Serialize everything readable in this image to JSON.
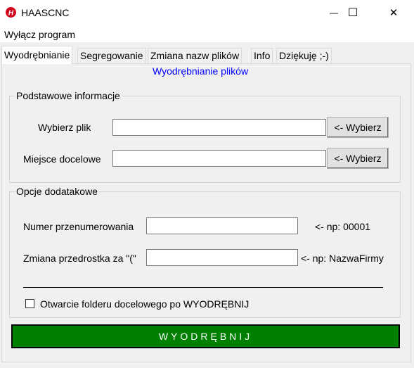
{
  "window": {
    "title": "HAASCNC",
    "icon": "haas-logo-icon",
    "minimize_glyph": "—",
    "maximize_glyph": "☐",
    "close_glyph": "✕"
  },
  "menu": {
    "items": [
      {
        "label": "Wyłącz program"
      }
    ]
  },
  "tabs": [
    {
      "label": "Wyodrębnianie",
      "active": true
    },
    {
      "label": "Segregowanie",
      "active": false
    },
    {
      "label": "Zmiana nazw plików",
      "active": false
    },
    {
      "label": "Info",
      "active": false
    },
    {
      "label": "Dziękuję ;-)",
      "active": false
    }
  ],
  "panel": {
    "title": "Wyodrębnianie plików",
    "basic": {
      "legend": "Podstawowe informacje",
      "file_label": "Wybierz plik",
      "file_value": "",
      "file_button": "<- Wybierz",
      "dest_label": "Miejsce docelowe",
      "dest_value": "",
      "dest_button": "<- Wybierz"
    },
    "options": {
      "legend": "Opcje dodatakowe",
      "renumber_label": "Numer przenumerowania",
      "renumber_value": "",
      "renumber_hint": "<- np: 00001",
      "prefix_label": "Zmiana przedrostka za \"(\"",
      "prefix_value": "",
      "prefix_hint": "<- np: NazwaFirmy",
      "open_folder_label": "Otwarcie folderu docelowego po WYODRĘBNIJ",
      "open_folder_checked": false
    },
    "extract_button": "WYODRĘBNIJ"
  },
  "colors": {
    "panel_title": "#0000ff",
    "extract_button_bg": "#008000",
    "extract_button_text": "#ffffff"
  }
}
